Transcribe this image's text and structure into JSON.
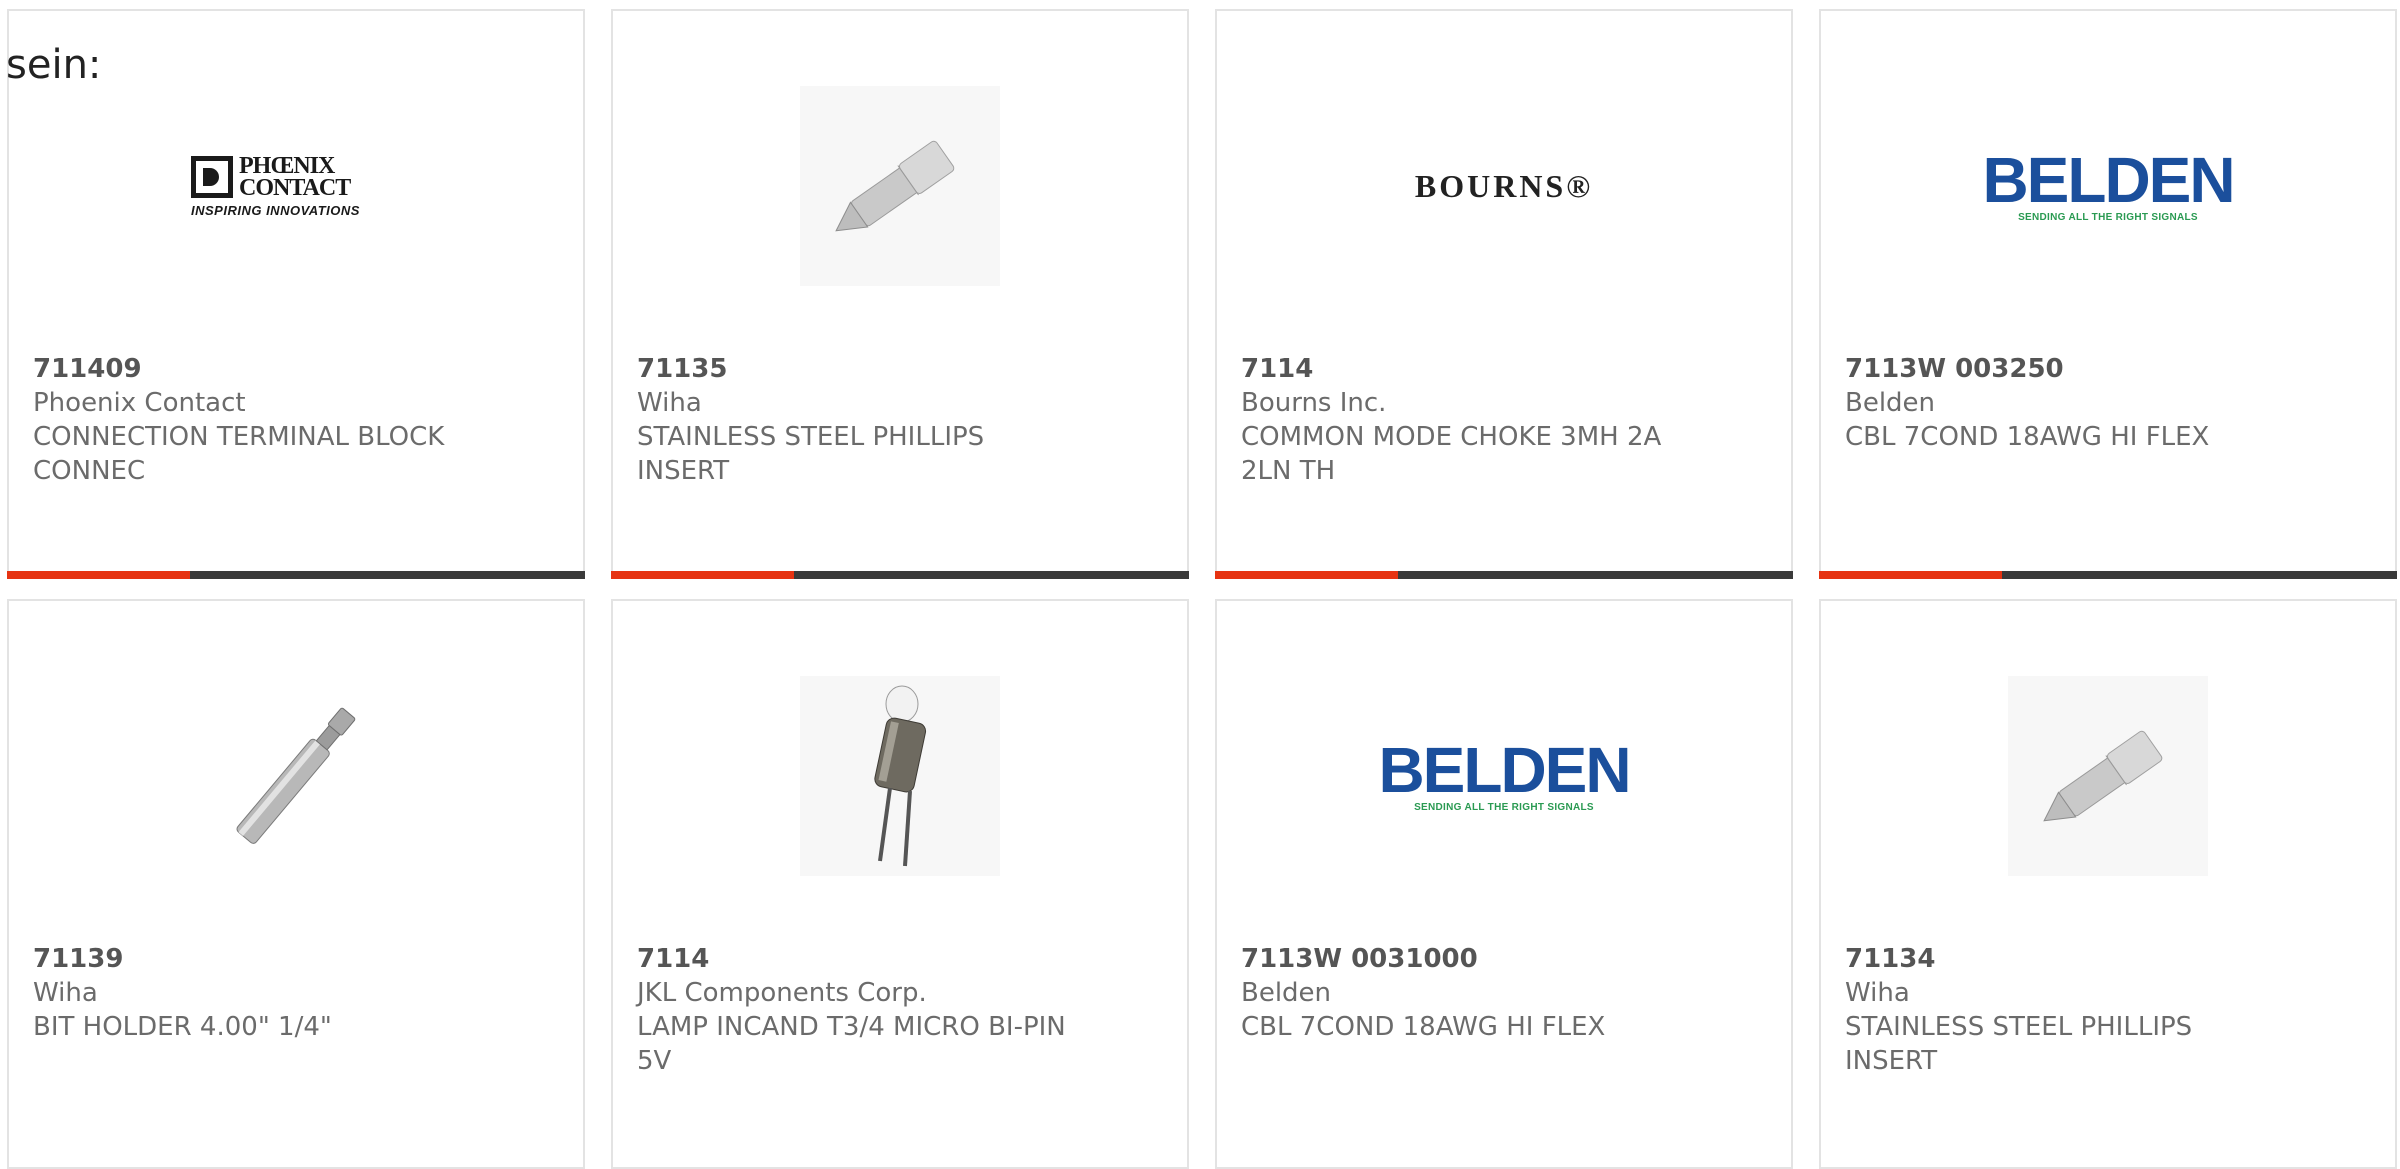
{
  "lead_text": "sein:",
  "colors": {
    "accent": "#e63312",
    "bar": "#3a3a3a",
    "border": "#e3e3e3",
    "belden_blue": "#1b4f9c",
    "belden_green": "#2a9a52"
  },
  "logos": {
    "phoenix": {
      "name_line1": "PHŒNIX",
      "name_line2": "CONTACT",
      "tagline": "INSPIRING INNOVATIONS"
    },
    "bourns": {
      "name": "BOURNS®"
    },
    "belden": {
      "name": "BELDEN",
      "tagline": "SENDING ALL THE RIGHT SIGNALS"
    }
  },
  "products": [
    {
      "part_number": "711409",
      "manufacturer": "Phoenix Contact",
      "description": "CONNECTION TERMINAL BLOCK CONNEC",
      "image": "phoenix-contact-logo"
    },
    {
      "part_number": "71135",
      "manufacturer": "Wiha",
      "description": "STAINLESS STEEL PHILLIPS INSERT",
      "image": "phillips-bit-photo"
    },
    {
      "part_number": "7114",
      "manufacturer": "Bourns Inc.",
      "description": "COMMON MODE CHOKE 3MH 2A 2LN TH",
      "image": "bourns-logo"
    },
    {
      "part_number": "7113W 003250",
      "manufacturer": "Belden",
      "description": "CBL 7COND 18AWG HI FLEX",
      "image": "belden-logo"
    },
    {
      "part_number": "71139",
      "manufacturer": "Wiha",
      "description": "BIT HOLDER 4.00\" 1/4\"",
      "image": "bit-holder-photo"
    },
    {
      "part_number": "7114",
      "manufacturer": "JKL Components Corp.",
      "description": "LAMP INCAND T3/4 MICRO BI-PIN 5V",
      "image": "lamp-photo"
    },
    {
      "part_number": "7113W 0031000",
      "manufacturer": "Belden",
      "description": "CBL 7COND 18AWG HI FLEX",
      "image": "belden-logo"
    },
    {
      "part_number": "71134",
      "manufacturer": "Wiha",
      "description": "STAINLESS STEEL PHILLIPS INSERT",
      "image": "phillips-bit-photo"
    }
  ]
}
